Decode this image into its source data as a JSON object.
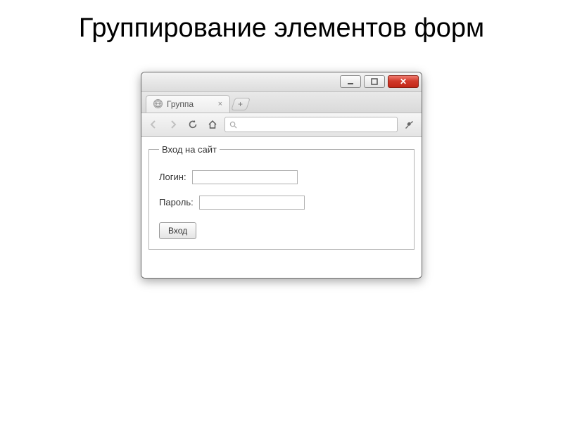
{
  "slide": {
    "title": "Группирование элементов форм"
  },
  "browser": {
    "tab_title": "Группа",
    "address_icon": "🔍"
  },
  "form": {
    "legend": "Вход на сайт",
    "login_label": "Логин:",
    "login_value": "",
    "password_label": "Пароль:",
    "password_value": "",
    "submit_label": "Вход"
  }
}
